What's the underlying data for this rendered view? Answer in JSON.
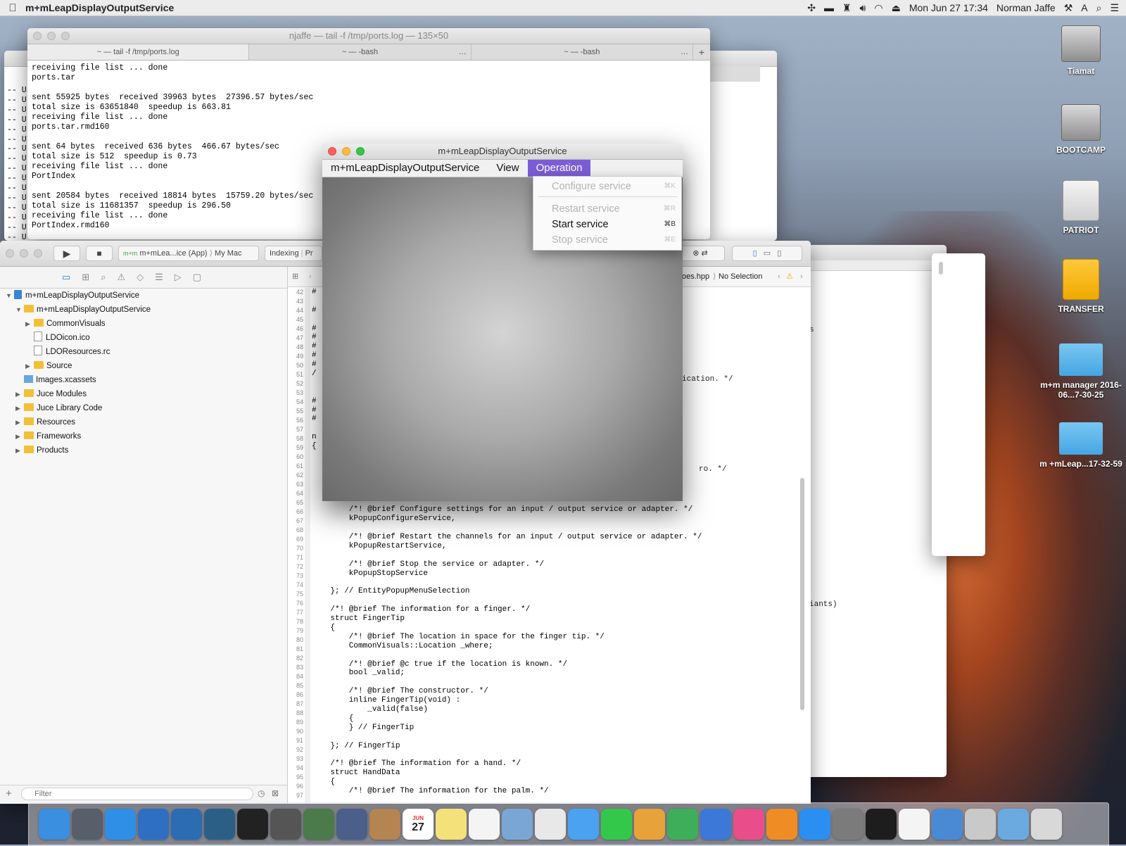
{
  "menubar": {
    "app_name": "m+mLeapDisplayOutputService",
    "clock": "Mon Jun 27  17:34",
    "user": "Norman Jaffe"
  },
  "terminal": {
    "title": "njaffe — tail -f /tmp/ports.log — 135×50",
    "tabs": [
      "~ — tail -f /tmp/ports.log",
      "~ — -bash",
      "~ — -bash"
    ],
    "back_tab": "ash",
    "lines": [
      "receiving file list ... done",
      "ports.tar",
      "",
      "sent 55925 bytes  received 39963 bytes  27396.57 bytes/sec",
      "total size is 63651840  speedup is 663.81",
      "receiving file list ... done",
      "ports.tar.rmd160",
      "",
      "sent 64 bytes  received 636 bytes  466.67 bytes/sec",
      "total size is 512  speedup is 0.73",
      "receiving file list ... done",
      "PortIndex",
      "",
      "sent 20584 bytes  received 18814 bytes  15759.20 bytes/sec",
      "total size is 11681357  speedup is 296.50",
      "receiving file list ... done",
      "PortIndex.rmd160"
    ],
    "left_fragments": [
      "-- U",
      "-- U",
      "-- U",
      "-- U",
      "-- U",
      "-- U",
      "-- U",
      "-- U",
      "-- U",
      "-- U",
      "-- U",
      "-- U",
      "-- U",
      "-- U",
      "-- U",
      "-- U"
    ]
  },
  "xcode": {
    "scheme": "m+mLea...ice (App)",
    "scheme_badge": "m+m",
    "destination": "My Mac",
    "activity": "Indexing",
    "activity_tail": "Pr",
    "jump_file": "oes.hpp",
    "jump_selection": "No Selection",
    "filter_placeholder": "Filter",
    "navigator": [
      {
        "label": "m+mLeapDisplayOutputService",
        "depth": 0,
        "icon": "project",
        "open": true
      },
      {
        "label": "m+mLeapDisplayOutputService",
        "depth": 1,
        "icon": "folder",
        "open": true
      },
      {
        "label": "CommonVisuals",
        "depth": 2,
        "icon": "folder",
        "open": false
      },
      {
        "label": "LDOicon.ico",
        "depth": 2,
        "icon": "file"
      },
      {
        "label": "LDOResources.rc",
        "depth": 2,
        "icon": "file"
      },
      {
        "label": "Source",
        "depth": 2,
        "icon": "folder",
        "open": false
      },
      {
        "label": "Images.xcassets",
        "depth": 1,
        "icon": "asset"
      },
      {
        "label": "Juce Modules",
        "depth": 1,
        "icon": "folder",
        "open": false
      },
      {
        "label": "Juce Library Code",
        "depth": 1,
        "icon": "folder",
        "open": false
      },
      {
        "label": "Resources",
        "depth": 1,
        "icon": "folder",
        "open": false
      },
      {
        "label": "Frameworks",
        "depth": 1,
        "icon": "folder",
        "open": false
      },
      {
        "label": "Products",
        "depth": 1,
        "icon": "folder",
        "open": false
      }
    ],
    "line_numbers": [
      "42",
      "43",
      "44",
      "45",
      "46",
      "47",
      "48",
      "49",
      "50",
      "51",
      "52",
      "53",
      "54",
      "55",
      "56",
      "57",
      "58",
      "59",
      "60",
      "61",
      "62",
      "63",
      "64",
      "65",
      "66",
      "67",
      "68",
      "69",
      "70",
      "71",
      "72",
      "73",
      "74",
      "75",
      "76",
      "77",
      "78",
      "79",
      "80",
      "81",
      "82",
      "83",
      "84",
      "85",
      "86",
      "87",
      "88",
      "89",
      "90",
      "91",
      "92",
      "93",
      "94",
      "95",
      "96",
      "97"
    ],
    "code_lines": [
      {
        "t": "#",
        "c": ""
      },
      {
        "t": "",
        "c": ""
      },
      {
        "t": "#",
        "c": ""
      },
      {
        "t": "",
        "c": ""
      },
      {
        "t": "#",
        "c": ""
      },
      {
        "t": "#",
        "c": ""
      },
      {
        "t": "#",
        "c": ""
      },
      {
        "t": "#",
        "c": ""
      },
      {
        "t": "#",
        "c": ""
      },
      {
        "t": "/",
        "c": "cm"
      },
      {
        "t": "",
        "c": ""
      },
      {
        "t": "",
        "c": ""
      },
      {
        "t": "#",
        "c": ""
      },
      {
        "t": "#",
        "c": ""
      },
      {
        "t": "#",
        "c": ""
      },
      {
        "t": "",
        "c": ""
      },
      {
        "t": "n",
        "c": "kw"
      },
      {
        "t": "{",
        "c": ""
      },
      {
        "t": "",
        "c": ""
      },
      {
        "t": "",
        "c": ""
      },
      {
        "t": "",
        "c": ""
      },
      {
        "t": "",
        "c": ""
      },
      {
        "t": "",
        "c": ""
      },
      {
        "t": "",
        "c": ""
      },
      {
        "t": "        /*! @brief Configure settings for an input / output service or adapter. */",
        "c": "cm"
      },
      {
        "t": "        kPopupConfigureService,",
        "c": ""
      },
      {
        "t": "",
        "c": ""
      },
      {
        "t": "        /*! @brief Restart the channels for an input / output service or adapter. */",
        "c": "cm"
      },
      {
        "t": "        kPopupRestartService,",
        "c": ""
      },
      {
        "t": "",
        "c": ""
      },
      {
        "t": "        /*! @brief Stop the service or adapter. */",
        "c": "cm"
      },
      {
        "t": "        kPopupStopService",
        "c": ""
      },
      {
        "t": "",
        "c": ""
      },
      {
        "t": "    }; // EntityPopupMenuSelection",
        "c": "cm"
      },
      {
        "t": "",
        "c": ""
      },
      {
        "t": "    /*! @brief The information for a finger. */",
        "c": "cm"
      },
      {
        "t": "    struct FingerTip",
        "c": "kw"
      },
      {
        "t": "    {",
        "c": ""
      },
      {
        "t": "        /*! @brief The location in space for the finger tip. */",
        "c": "cm"
      },
      {
        "t": "        CommonVisuals::Location _where;",
        "c": "ty"
      },
      {
        "t": "",
        "c": ""
      },
      {
        "t": "        /*! @brief @c true if the location is known. */",
        "c": "cm"
      },
      {
        "t": "        bool _valid;",
        "c": "kw"
      },
      {
        "t": "",
        "c": ""
      },
      {
        "t": "        /*! @brief The constructor. */",
        "c": "cm"
      },
      {
        "t": "        inline FingerTip(void) :",
        "c": "kw"
      },
      {
        "t": "            _valid(false)",
        "c": "ty"
      },
      {
        "t": "        {",
        "c": ""
      },
      {
        "t": "        } // FingerTip",
        "c": "cm"
      },
      {
        "t": "",
        "c": ""
      },
      {
        "t": "    }; // FingerTip",
        "c": "cm"
      },
      {
        "t": "",
        "c": ""
      },
      {
        "t": "    /*! @brief The information for a hand. */",
        "c": "cm"
      },
      {
        "t": "    struct HandData",
        "c": "kw"
      },
      {
        "t": "    {",
        "c": ""
      },
      {
        "t": "        /*! @brief The information for the palm. */",
        "c": "cm"
      }
    ],
    "right_fragments": {
      "a": "ication. */",
      "b": "ro. */",
      "c": "s",
      "d": "iants)"
    }
  },
  "app_window": {
    "title": "m+mLeapDisplayOutputService",
    "menus": [
      "m+mLeapDisplayOutputService",
      "View",
      "Operation"
    ]
  },
  "operation_menu": {
    "items": [
      {
        "label": "Configure service",
        "shortcut": "⌘K",
        "enabled": false
      },
      {
        "label": "Restart service",
        "shortcut": "⌘R",
        "enabled": false
      },
      {
        "label": "Start service",
        "shortcut": "⌘B",
        "enabled": true
      },
      {
        "label": "Stop service",
        "shortcut": "⌘E",
        "enabled": false
      }
    ]
  },
  "desktop": {
    "icons": [
      {
        "label": "Tiamat",
        "kind": "hdd"
      },
      {
        "label": "BOOTCAMP",
        "kind": "hdd"
      },
      {
        "label": "PATRIOT",
        "kind": "usb"
      },
      {
        "label": "TRANSFER",
        "kind": "usb-yellow"
      },
      {
        "label": "m+m manager 2016-06...7-30-25",
        "kind": "folder"
      },
      {
        "label": "m +mLeap...17-32-59",
        "kind": "folder"
      }
    ]
  },
  "dock": {
    "items": [
      "Finder",
      "Launchpad",
      "Safari",
      "Xcode",
      "Visual Studio Code",
      "SourceTree",
      "Terminal",
      "m+m",
      "m+m",
      "m+m",
      "Contacts",
      "Calendar",
      "Notes",
      "Reminders",
      "Preview",
      "Photos",
      "Messages",
      "FaceTime",
      "Pages",
      "Numbers",
      "Keynote",
      "iTunes",
      "iBooks",
      "App Store",
      "System Preferences",
      "Activity Monitor",
      "TextEdit",
      "Tool",
      "Utility",
      "Downloads",
      "Trash"
    ],
    "calendar_month": "JUN",
    "calendar_day": "27"
  }
}
